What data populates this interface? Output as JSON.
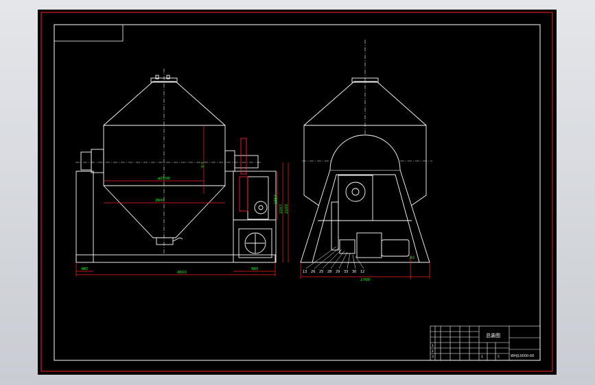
{
  "colors": {
    "background": "#000000",
    "outer_frame": "#ff2020",
    "drawing_lines": "#ffffff",
    "dimensions": "#00ff00",
    "dimension_lines": "#ff2020",
    "viewport": "#d8dadf"
  },
  "front_view": {
    "diameter_label": "ø2500",
    "inner_width_label": "2640",
    "height_label": "1:6",
    "left_offset_label": "480",
    "total_width_label": "4300",
    "motor_width_label": "900",
    "shaft_height_labels": [
      "1957",
      "2057",
      "2200"
    ]
  },
  "side_view": {
    "base_width_label": "2700",
    "right_offset_label": "80",
    "part_balloons": [
      "13",
      "26",
      "25",
      "28",
      "29",
      "33",
      "30",
      "12"
    ]
  },
  "title_block": {
    "title": "总装图",
    "drawing_number": "WHJ10000-00",
    "row_numbers": [
      "1",
      "2",
      "3"
    ],
    "scale_cells": [
      "1",
      "5"
    ]
  }
}
